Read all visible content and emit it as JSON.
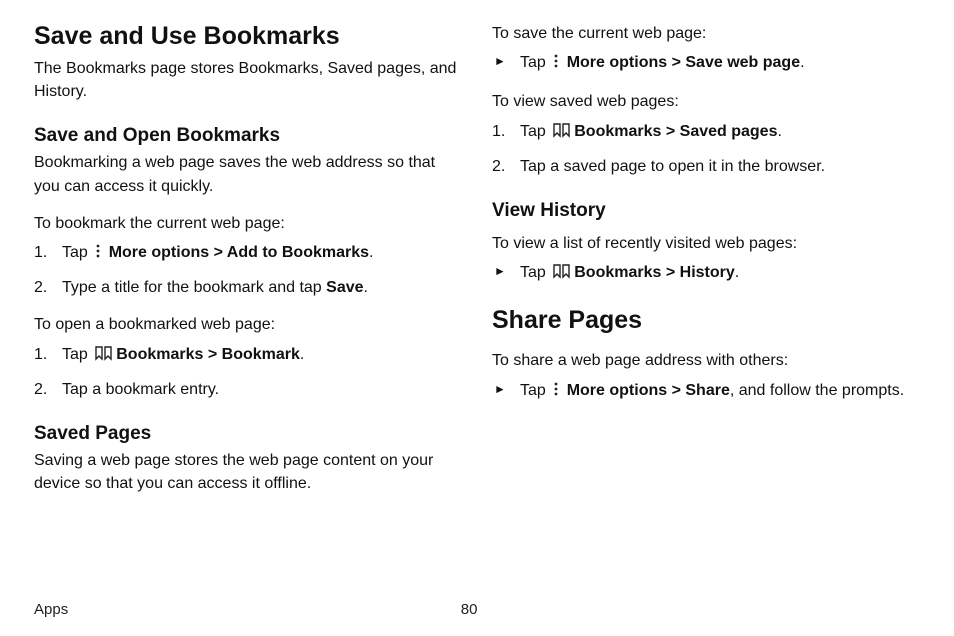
{
  "footer": {
    "section": "Apps",
    "page": "80"
  },
  "left": {
    "h1": "Save and Use Bookmarks",
    "p1": "The Bookmarks page stores Bookmarks, Saved pages, and History.",
    "h2a": "Save and Open Bookmarks",
    "p2": "Bookmarking a web page saves the web address so that you can access it quickly.",
    "intro1": "To bookmark the current web page:",
    "s1a_pre": "Tap ",
    "s1a_more": "More options",
    "s1a_gt": " > ",
    "s1a_add": "Add to Bookmarks",
    "s1a_post": ".",
    "s1b_pre": "Type a title for the bookmark and tap ",
    "s1b_save": "Save",
    "s1b_post": ".",
    "intro2": "To open a bookmarked web page:",
    "s2a_pre": "Tap ",
    "s2a_bk": "Bookmarks",
    "s2a_gt": " > ",
    "s2a_bm": "Bookmark",
    "s2a_post": ".",
    "s2b": "Tap a bookmark entry.",
    "h2b": "Saved Pages",
    "p3": "Saving a web page stores the web page content on your device so that you can access it offline."
  },
  "right": {
    "intro1": "To save the current web page:",
    "b1_pre": "Tap ",
    "b1_more": "More options",
    "b1_gt": " > ",
    "b1_save": "Save web page",
    "b1_post": ".",
    "intro2": "To view saved web pages:",
    "s1a_pre": "Tap ",
    "s1a_bk": "Bookmarks",
    "s1a_gt": " > ",
    "s1a_sp": "Saved pages",
    "s1a_post": ".",
    "s1b": "Tap a saved page to open it in the browser.",
    "h2a": "View History",
    "intro3": "To view a list of recently visited web pages:",
    "b2_pre": "Tap ",
    "b2_bk": "Bookmarks",
    "b2_gt": " > ",
    "b2_hist": "History",
    "b2_post": ".",
    "h1b": "Share Pages",
    "intro4": "To share a web page address with others:",
    "b3_pre": "Tap ",
    "b3_more": "More options",
    "b3_gt": " > ",
    "b3_share": "Share",
    "b3_post": ", and follow the prompts."
  }
}
